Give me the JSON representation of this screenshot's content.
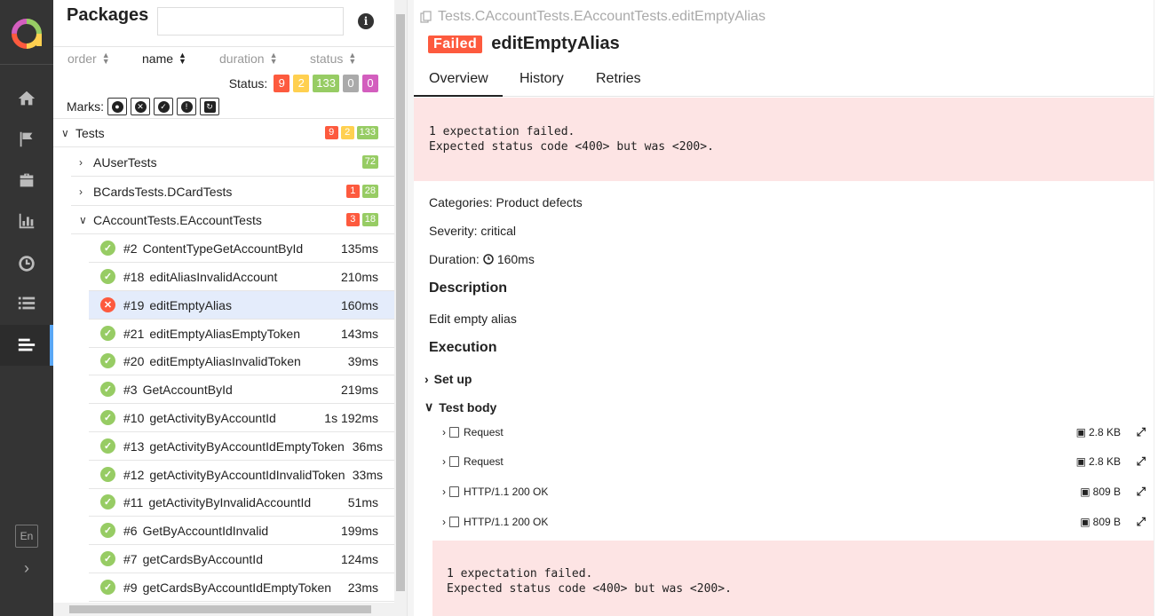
{
  "sidebar": {
    "items": [
      {
        "name": "home-icon"
      },
      {
        "name": "flag-icon"
      },
      {
        "name": "briefcase-icon"
      },
      {
        "name": "bar-chart-icon"
      },
      {
        "name": "clock-icon"
      },
      {
        "name": "list-icon"
      },
      {
        "name": "align-left-icon"
      }
    ],
    "lang": "En"
  },
  "packages": {
    "title": "Packages",
    "search_placeholder": "",
    "sort": [
      "order",
      "name",
      "duration",
      "status"
    ],
    "status_label": "Status:",
    "status_counts": [
      "9",
      "2",
      "133",
      "0",
      "0"
    ],
    "marks_label": "Marks:"
  },
  "tree": {
    "root": {
      "label": "Tests",
      "badges": [
        "9",
        "2",
        "133"
      ]
    },
    "groups": [
      {
        "label": "AUserTests",
        "badges": [
          "72"
        ]
      },
      {
        "label": "BCardsTests.DCardTests",
        "badges": [
          "1",
          "28"
        ]
      },
      {
        "label": "CAccountTests.EAccountTests",
        "badges": [
          "3",
          "18"
        ]
      }
    ],
    "tests": [
      {
        "num": "#2",
        "name": "ContentTypeGetAccountById",
        "dur": "135ms"
      },
      {
        "num": "#18",
        "name": "editAliasInvalidAccount",
        "dur": "210ms"
      },
      {
        "num": "#19",
        "name": "editEmptyAlias",
        "dur": "160ms"
      },
      {
        "num": "#21",
        "name": "editEmptyAliasEmptyToken",
        "dur": "143ms"
      },
      {
        "num": "#20",
        "name": "editEmptyAliasInvalidToken",
        "dur": "39ms"
      },
      {
        "num": "#3",
        "name": "GetAccountById",
        "dur": "219ms"
      },
      {
        "num": "#10",
        "name": "getActivityByAccountId",
        "dur": "1s 192ms"
      },
      {
        "num": "#13",
        "name": "getActivityByAccountIdEmptyToken",
        "dur": "36ms"
      },
      {
        "num": "#12",
        "name": "getActivityByAccountIdInvalidToken",
        "dur": "33ms"
      },
      {
        "num": "#11",
        "name": "getActivityByInvalidAccountId",
        "dur": "51ms"
      },
      {
        "num": "#6",
        "name": "GetByAccountIdInvalid",
        "dur": "199ms"
      },
      {
        "num": "#7",
        "name": "getCardsByAccountId",
        "dur": "124ms"
      },
      {
        "num": "#9",
        "name": "getCardsByAccountIdEmptyToken",
        "dur": "23ms"
      }
    ]
  },
  "detail": {
    "breadcrumb": "Tests.CAccountTests.EAccountTests.editEmptyAlias",
    "status": "Failed",
    "title": "editEmptyAlias",
    "tabs": [
      "Overview",
      "History",
      "Retries"
    ],
    "error": "1 expectation failed.\nExpected status code <400> but was <200>.",
    "categories": "Categories: Product defects",
    "severity": "Severity: critical",
    "duration_label": "Duration:",
    "duration": "160ms",
    "description_h": "Description",
    "description": "Edit empty alias",
    "execution_h": "Execution",
    "setup": "Set up",
    "testbody": "Test body",
    "attachments": [
      {
        "label": "Request",
        "size": "2.8 KB"
      },
      {
        "label": "Request",
        "size": "2.8 KB"
      },
      {
        "label": "HTTP/1.1 200 OK",
        "size": "809 B"
      },
      {
        "label": "HTTP/1.1 200 OK",
        "size": "809 B"
      }
    ],
    "error2": "1 expectation failed.\nExpected status code <400> but was <200>."
  },
  "colors": {
    "failed": "#fd5a3e",
    "passed": "#97cc64",
    "broken": "#ffd050",
    "unknown": "#d35ebe",
    "skipped": "#aaaaaa",
    "accent": "#5aa7f5"
  }
}
